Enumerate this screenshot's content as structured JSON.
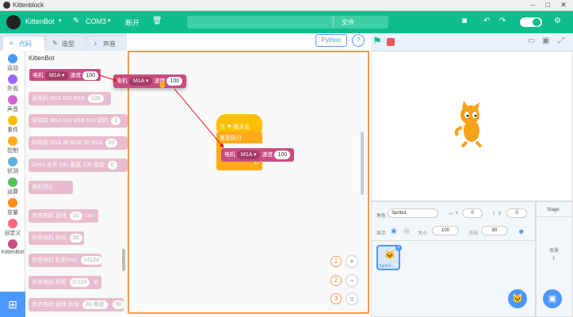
{
  "app": {
    "title": "Kittenblock"
  },
  "menubar": {
    "brand": "KittenBot",
    "port": "COM3",
    "device_label": "断开",
    "file_label": "文件"
  },
  "tabs": [
    {
      "label": "代码"
    },
    {
      "label": "造型"
    },
    {
      "label": "声音"
    }
  ],
  "toolbar": {
    "python_label": "Python",
    "help_label": "?"
  },
  "categories": [
    {
      "label": "运动",
      "color": "#4c97ff"
    },
    {
      "label": "外观",
      "color": "#9966ff"
    },
    {
      "label": "声音",
      "color": "#cf63cf"
    },
    {
      "label": "事件",
      "color": "#ffbf00"
    },
    {
      "label": "控制",
      "color": "#ffab19"
    },
    {
      "label": "侦测",
      "color": "#5cb1d6"
    },
    {
      "label": "运算",
      "color": "#59c059"
    },
    {
      "label": "变量",
      "color": "#ff8c1a"
    },
    {
      "label": "自定义",
      "color": "#ff6680"
    },
    {
      "label": "KittenBot",
      "color": "#c94d81"
    }
  ],
  "palette": {
    "header": "KittenBot",
    "blocks": [
      {
        "prefix": "电机",
        "dd": "M1A ▾",
        "mid": "速度",
        "val": "100"
      },
      {
        "prefix": "双电机 M1A",
        "dd": "",
        "mid": "100 M1B",
        "val": "100"
      },
      {
        "prefix": "双电机 M1A",
        "dd": "",
        "mid": "100 M1B 100 延时",
        "val": "1"
      },
      {
        "prefix": "四电机 M1A",
        "dd": "",
        "mid": "30 M1B 30 M2A",
        "val": "30"
      },
      {
        "prefix": "Omni 水平",
        "dd": "",
        "mid": "100 垂直 100 旋转",
        "val": "0"
      },
      {
        "prefix": "电机停止",
        "dd": "",
        "mid": "",
        "val": ""
      },
      {
        "prefix": "步进电机 直线",
        "dd": "",
        "mid": "20",
        "val": "cm"
      },
      {
        "prefix": "步进电机 转向",
        "dd": "",
        "mid": "90",
        "val": ""
      },
      {
        "prefix": "步进电机 轮距/mm",
        "dd": "",
        "mid": "14124",
        "val": ""
      },
      {
        "prefix": "步进电机 轮距",
        "dd": "",
        "mid": "0.124",
        "val": "米"
      },
      {
        "prefix": "步进电机 弧线 直径",
        "dd": "",
        "mid": "20 角度",
        "val": "90"
      }
    ]
  },
  "workspace": {
    "dragged_block": {
      "prefix": "电机",
      "dd": "M1A ▾",
      "mid": "速度",
      "val": "100"
    },
    "hat_label": "当 ⚑ 被点击",
    "forever_label": "重复执行",
    "motor_block": {
      "prefix": "电机",
      "dd": "M1A ▾",
      "mid": "速度",
      "val": "100"
    },
    "zoom": {
      "in": "+",
      "out": "−",
      "reset": "="
    },
    "callouts": [
      "1",
      "2",
      "3"
    ]
  },
  "sprite_info": {
    "sprite_label": "角色",
    "sprite_name": "Sprite1",
    "x_label": "x",
    "x_value": "0",
    "y_label": "y",
    "y_value": "0",
    "show_label": "显示",
    "size_label": "大小",
    "size_value": "100",
    "direction_label": "方向",
    "direction_value": "90",
    "thumb_name": "Sprite1"
  },
  "stage_pane": {
    "title": "Stage",
    "backdrops_label": "背景",
    "backdrops_count": "1"
  }
}
